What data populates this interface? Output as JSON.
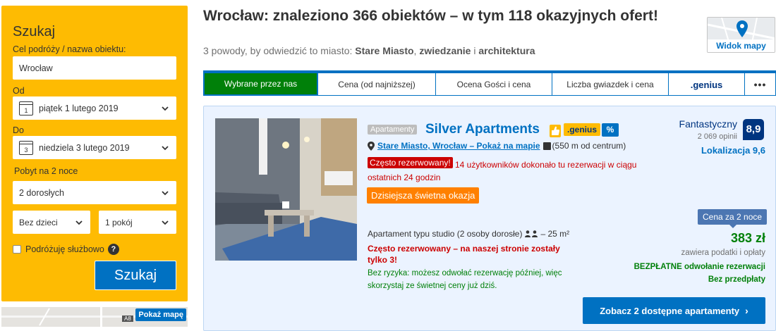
{
  "search": {
    "title": "Szukaj",
    "destination_label": "Cel podróży / nazwa obiektu:",
    "destination_value": "Wrocław",
    "checkin_label": "Od",
    "checkin_day": "1",
    "checkin_value": "piątek 1 lutego 2019",
    "checkout_label": "Do",
    "checkout_day": "3",
    "checkout_value": "niedziela 3 lutego 2019",
    "stay_label": "Pobyt na 2 noce",
    "adults_value": "2 dorosłych",
    "children_value": "Bez dzieci",
    "rooms_value": "1 pokój",
    "business_label": "Podróżuję służbowo",
    "help_glyph": "?",
    "submit_label": "Szukaj"
  },
  "map_preview": {
    "button_label": "Pokaż mapę",
    "road_label": "A8"
  },
  "header": {
    "title": "Wrocław: znaleziono 366 obiektów – w tym 118 okazyjnych ofert!",
    "subtitle_prefix": "3 powody, by odwiedzić to miasto: ",
    "reason_1": "Stare Miasto",
    "sep_1": ", ",
    "reason_2": "zwiedzanie",
    "sep_2": " i ",
    "reason_3": "architektura"
  },
  "map_view": {
    "label": "Widok mapy"
  },
  "sort_tabs": [
    {
      "label": "Wybrane przez nas",
      "active": true
    },
    {
      "label": "Cena (od najniższej)",
      "active": false
    },
    {
      "label": "Ocena Gości i cena",
      "active": false
    },
    {
      "label": "Liczba gwiazdek i cena",
      "active": false
    },
    {
      "label": ".genius",
      "active": false
    },
    {
      "label": "•••",
      "active": false
    }
  ],
  "property": {
    "type_badge": "Apartamenty",
    "name": "Silver Apartments",
    "genius_badge": ".genius",
    "percent_badge": "%",
    "location_link": "Stare Miasto, Wrocław – Pokaż na mapie",
    "distance": "(550 m od centrum)",
    "often_tag": "Często rezerwowany!",
    "often_text": "14 użytkowników dokonało tu rezerwacji w ciągu ostatnich 24 godzin",
    "deal_label": "Dzisiejsza świetna okazja",
    "unit_prefix": "Apartament typu studio (2 osoby dorosłe)",
    "unit_suffix": "– 25 m²",
    "warning": "Często rezerwowany – na naszej stronie zostały tylko 3!",
    "no_risk": "Bez ryzyka: możesz odwołać rezerwację później, więc skorzystaj ze świetnej ceny już dziś.",
    "score_word": "Fantastyczny",
    "review_count": "2 069 opinii",
    "score": "8,9",
    "location_score": "Lokalizacja 9,6",
    "price_tag": "Cena za 2 noce",
    "price": "383 zł",
    "price_note": "zawiera podatki i opłaty",
    "free_cancel": "BEZPŁATNE odwołanie rezerwacji",
    "no_prepay": "Bez przedpłaty",
    "cta_label": "Zobacz 2 dostępne apartamenty",
    "cta_arrow": "›"
  },
  "colors": {
    "brand_blue": "#0071c2",
    "navy": "#003580",
    "search_yellow": "#febb02",
    "active_green": "#008009",
    "urgent_red": "#cc0000",
    "deal_orange": "#ff8000"
  }
}
